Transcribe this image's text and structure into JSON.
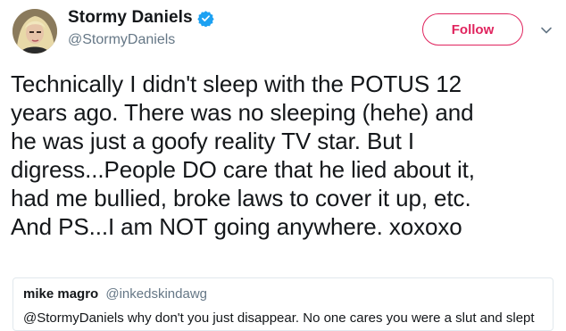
{
  "tweet": {
    "author": {
      "display_name": "Stormy Daniels",
      "handle": "@StormyDaniels",
      "avatar": "avatar-image",
      "verified_icon": "verified-badge-icon"
    },
    "follow_label": "Follow",
    "more_icon": "chevron-down-icon",
    "text": "Technically I didn't sleep with the POTUS 12\nyears ago. There was no sleeping (hehe) and\nhe was just a goofy reality TV star.  But I\ndigress...People DO care that he lied about it,\nhad me bullied, broke laws to cover it up, etc.\nAnd PS...I am NOT going anywhere. xoxoxo"
  },
  "quoted_tweet": {
    "display_name": "mike magro",
    "handle": "@inkedskindawg",
    "text": "@StormyDaniels why don't you just disappear. No one cares you were a slut and slept"
  },
  "colors": {
    "accent": "#e0245e",
    "verified": "#1da1f2",
    "secondary_text": "#657786",
    "border": "#e1e8ed"
  }
}
